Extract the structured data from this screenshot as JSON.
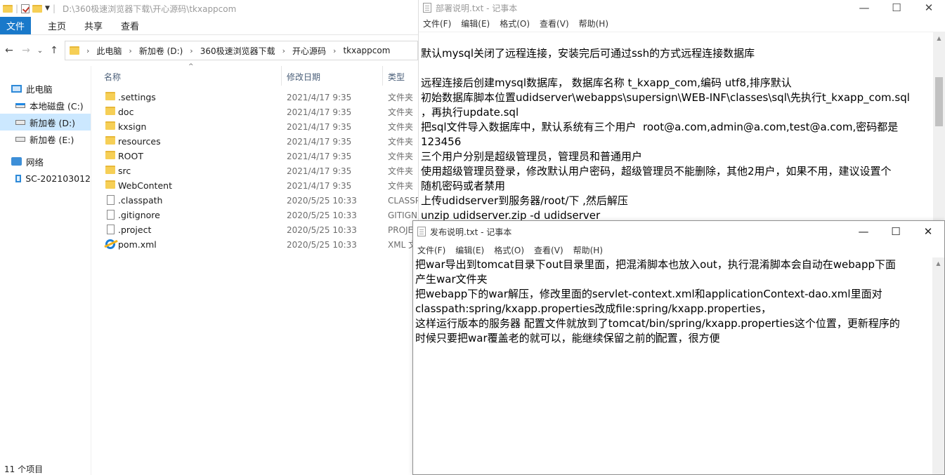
{
  "explorer": {
    "title_path": "D:\\360极速浏览器下载\\开心源码\\tkxappcom",
    "ribbon_tabs": [
      "文件",
      "主页",
      "共享",
      "查看"
    ],
    "breadcrumb": [
      "此电脑",
      "新加卷 (D:)",
      "360极速浏览器下载",
      "开心源码",
      "tkxappcom"
    ],
    "nav": [
      {
        "label": "此电脑",
        "icon": "computer-icon"
      },
      {
        "label": "本地磁盘 (C:)",
        "icon": "system-drive-icon"
      },
      {
        "label": "新加卷 (D:)",
        "icon": "drive-icon",
        "selected": true
      },
      {
        "label": "新加卷 (E:)",
        "icon": "drive-icon"
      },
      {
        "label": "网络",
        "icon": "network-icon"
      },
      {
        "label": "SC-202103012",
        "icon": "monitor-icon"
      }
    ],
    "columns": {
      "name": "名称",
      "date": "修改日期",
      "type": "类型"
    },
    "files": [
      {
        "name": ".settings",
        "date": "2021/4/17 9:35",
        "type": "文件夹",
        "icon": "folder-icon"
      },
      {
        "name": "doc",
        "date": "2021/4/17 9:35",
        "type": "文件夹",
        "icon": "folder-icon"
      },
      {
        "name": "kxsign",
        "date": "2021/4/17 9:35",
        "type": "文件夹",
        "icon": "folder-icon"
      },
      {
        "name": "resources",
        "date": "2021/4/17 9:35",
        "type": "文件夹",
        "icon": "folder-icon"
      },
      {
        "name": "ROOT",
        "date": "2021/4/17 9:35",
        "type": "文件夹",
        "icon": "folder-icon"
      },
      {
        "name": "src",
        "date": "2021/4/17 9:35",
        "type": "文件夹",
        "icon": "folder-icon"
      },
      {
        "name": "WebContent",
        "date": "2021/4/17 9:35",
        "type": "文件夹",
        "icon": "folder-icon"
      },
      {
        "name": ".classpath",
        "date": "2020/5/25 10:33",
        "type": "CLASSP",
        "icon": "file-icon"
      },
      {
        "name": ".gitignore",
        "date": "2020/5/25 10:33",
        "type": "GITIGN",
        "icon": "file-icon"
      },
      {
        "name": ".project",
        "date": "2020/5/25 10:33",
        "type": "PROJE",
        "icon": "file-icon"
      },
      {
        "name": "pom.xml",
        "date": "2020/5/25 10:33",
        "type": "XML 文",
        "icon": "ie-icon"
      }
    ],
    "status": "11 个项目"
  },
  "notepad1": {
    "title": "部署说明.txt - 记事本",
    "menu": [
      "文件(F)",
      "编辑(E)",
      "格式(O)",
      "查看(V)",
      "帮助(H)"
    ],
    "lines": [
      "默认mysql关闭了远程连接，安装完后可通过ssh的方式远程连接数据库",
      "",
      "远程连接后创建mysql数据库， 数据库名称 t_kxapp_com,编码 utf8,排序默认",
      "初始数据库脚本位置udidserver\\webapps\\supersign\\WEB-INF\\classes\\sql\\先执行t_kxapp_com.sql",
      "，再执行update.sql",
      "把sql文件导入数据库中，默认系统有三个用户  root@a.com,admin@a.com,test@a.com,密码都是",
      "123456",
      "三个用户分别是超级管理员，管理员和普通用户",
      "使用超级管理员登录，修改默认用户密码，超级管理员不能删除，其他2用户，如果不用，建议设置个",
      "随机密码或者禁用",
      "上传udidserver到服务器/root/下 ,然后解压",
      "unzip udidserver.zip -d udidserver"
    ]
  },
  "notepad2": {
    "title": "发布说明.txt - 记事本",
    "menu": [
      "文件(F)",
      "编辑(E)",
      "格式(O)",
      "查看(V)",
      "帮助(H)"
    ],
    "lines": [
      "把war导出到tomcat目录下out目录里面，把混淆脚本也放入out，执行混淆脚本会自动在webapp下面",
      "产生war文件夹",
      "把webapp下的war解压，修改里面的servlet-context.xml和applicationContext-dao.xml里面对",
      "classpath:spring/kxapp.properties改成file:spring/kxapp.properties，",
      "这样运行版本的服务器 配置文件就放到了tomcat/bin/spring/kxapp.properties这个位置，更新程序的"
    ],
    "last_line_before_caret": "时候只要把war覆盖老的就可以，能继续保留之前的",
    "last_line_after_caret": "配置，很方便"
  }
}
